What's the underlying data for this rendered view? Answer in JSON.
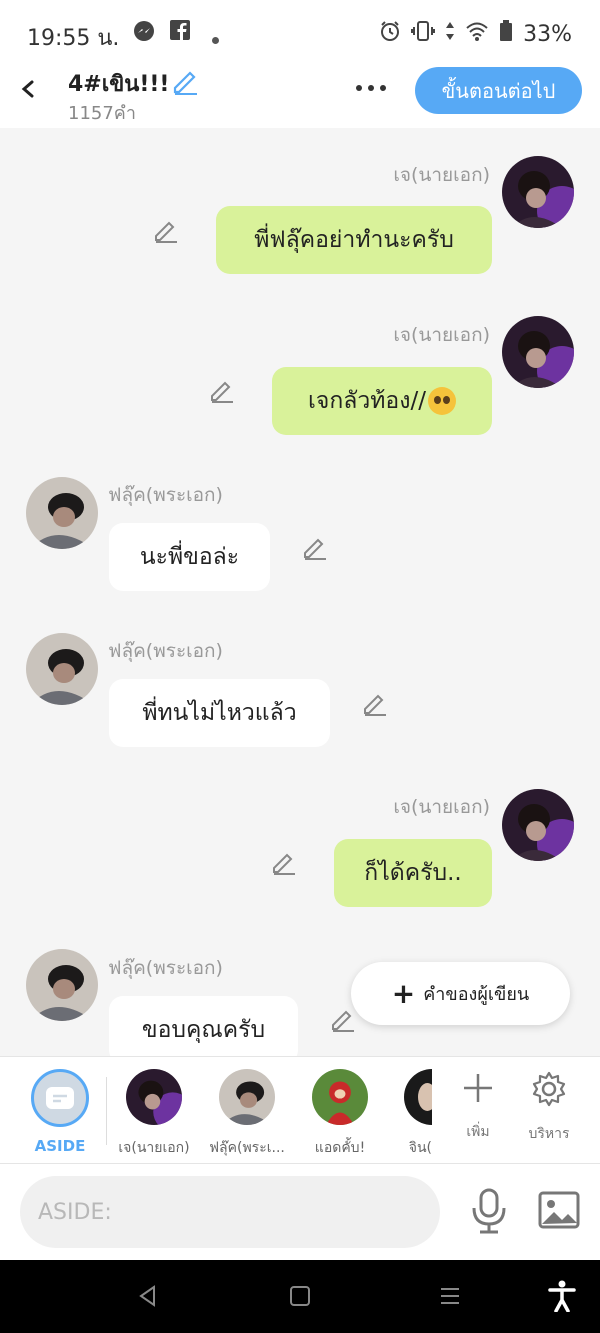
{
  "status_bar": {
    "time": "19:55 น.",
    "battery": "33%",
    "icons": [
      "messenger-icon",
      "facebook-icon",
      "dot-icon",
      "alarm-icon",
      "vibrate-icon",
      "data-arrows-icon",
      "wifi-icon",
      "battery-icon"
    ]
  },
  "header": {
    "title": "4#เขิน!!!",
    "word_count": "1157คำ",
    "next_button": "ขั้นตอนต่อไป"
  },
  "messages": [
    {
      "sender": "เจ(นายเอก)",
      "text": "พี่ฟลุ๊คอย่าทำนะครับ",
      "side": "right"
    },
    {
      "sender": "เจ(นายเอก)",
      "text": "เจกลัวท้อง//",
      "emoji": "pleading-face-emoji",
      "side": "right"
    },
    {
      "sender": "ฟลุ๊ค(พระเอก)",
      "text": "นะพี่ขอล่ะ",
      "side": "left"
    },
    {
      "sender": "ฟลุ๊ค(พระเอก)",
      "text": "พี่ทนไม่ไหวแล้ว",
      "side": "left"
    },
    {
      "sender": "เจ(นายเอก)",
      "text": "ก็ได้ครับ..",
      "side": "right"
    },
    {
      "sender": "ฟลุ๊ค(พระเอก)",
      "text": "ขอบคุณครับ",
      "side": "left"
    }
  ],
  "author_button": "คำของผู้เขียน",
  "characters": {
    "aside_label": "ASIDE",
    "items": [
      "เจ(นายเอก)",
      "ฟลุ๊ค(พระเ...",
      "แอดคั้บ!",
      "จิน("
    ],
    "add_label": "เพิ่ม",
    "manage_label": "บริหาร"
  },
  "input": {
    "placeholder": "ASIDE:"
  },
  "colors": {
    "accent": "#57a9f5",
    "my_bubble": "#d9f29a",
    "other_bubble": "#ffffff"
  }
}
